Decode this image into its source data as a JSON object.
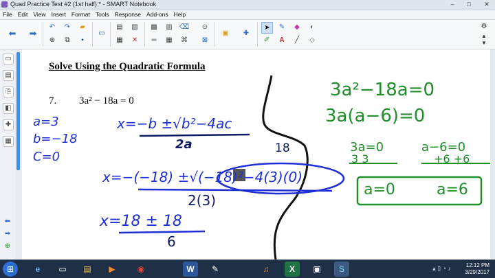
{
  "window": {
    "title": "Quad Practice Test #2 (1st half) * - SMART Notebook",
    "minimize": "–",
    "maximize": "□",
    "close": "✕"
  },
  "menu": [
    "File",
    "Edit",
    "View",
    "Insert",
    "Format",
    "Tools",
    "Response",
    "Add-ons",
    "Help"
  ],
  "toolbar": {
    "icons": [
      "back-arrow",
      "forward-arrow",
      "undo",
      "redo",
      "open-folder",
      "save",
      "display-screen",
      "paste",
      "insert-picture",
      "table",
      "delete",
      "clear-ink",
      "screen-shade",
      "properties",
      "lock",
      "add-on",
      "select-pointer",
      "pen",
      "eraser",
      "fill",
      "text",
      "line",
      "magic-pen"
    ],
    "settings_icon": "⚙",
    "up_arrow": "▲",
    "down_arrow": "▼"
  },
  "page": {
    "heading": "Solve Using the Quadratic Formula",
    "question_number": "7.",
    "question_equation": "3a² − 18a = 0"
  },
  "handwriting": {
    "coefficients": [
      "a=3",
      "b=−18",
      "C=0"
    ],
    "formula_numerator": "x=−b ±√b²−4ac",
    "formula_denominator": "2a",
    "annotation_18": "18",
    "substitution_numerator": "x=−(−18) ±√(−18)²−4(3)(0)",
    "substitution_denominator": "2(3)",
    "simplified_numerator": "x=18 ± 18",
    "simplified_denominator": "6",
    "factored_line1": "3a²−18a=0",
    "factored_line2": "3a(a−6)=0",
    "solve_left": "3a=0",
    "solve_left_div": "3    3",
    "solve_right": "a−6=0",
    "solve_right_add": "+6  +6",
    "answer_left": "a=0",
    "answer_right": "a=6"
  },
  "taskbar": {
    "start": "⊞",
    "apps": [
      "e",
      "▭",
      "▤",
      "▶",
      "◉",
      "W",
      "✎",
      "♫",
      "X",
      "▣",
      "S"
    ],
    "tray": "▴  ▯  ◔  ♪",
    "time": "12:12 PM",
    "date": "3/29/2017"
  },
  "colors": {
    "ink_blue": "#1f2fd6",
    "ink_green": "#1f8f2a",
    "ink_navy": "#0e1a66",
    "taskbar": "#1f2f46"
  }
}
